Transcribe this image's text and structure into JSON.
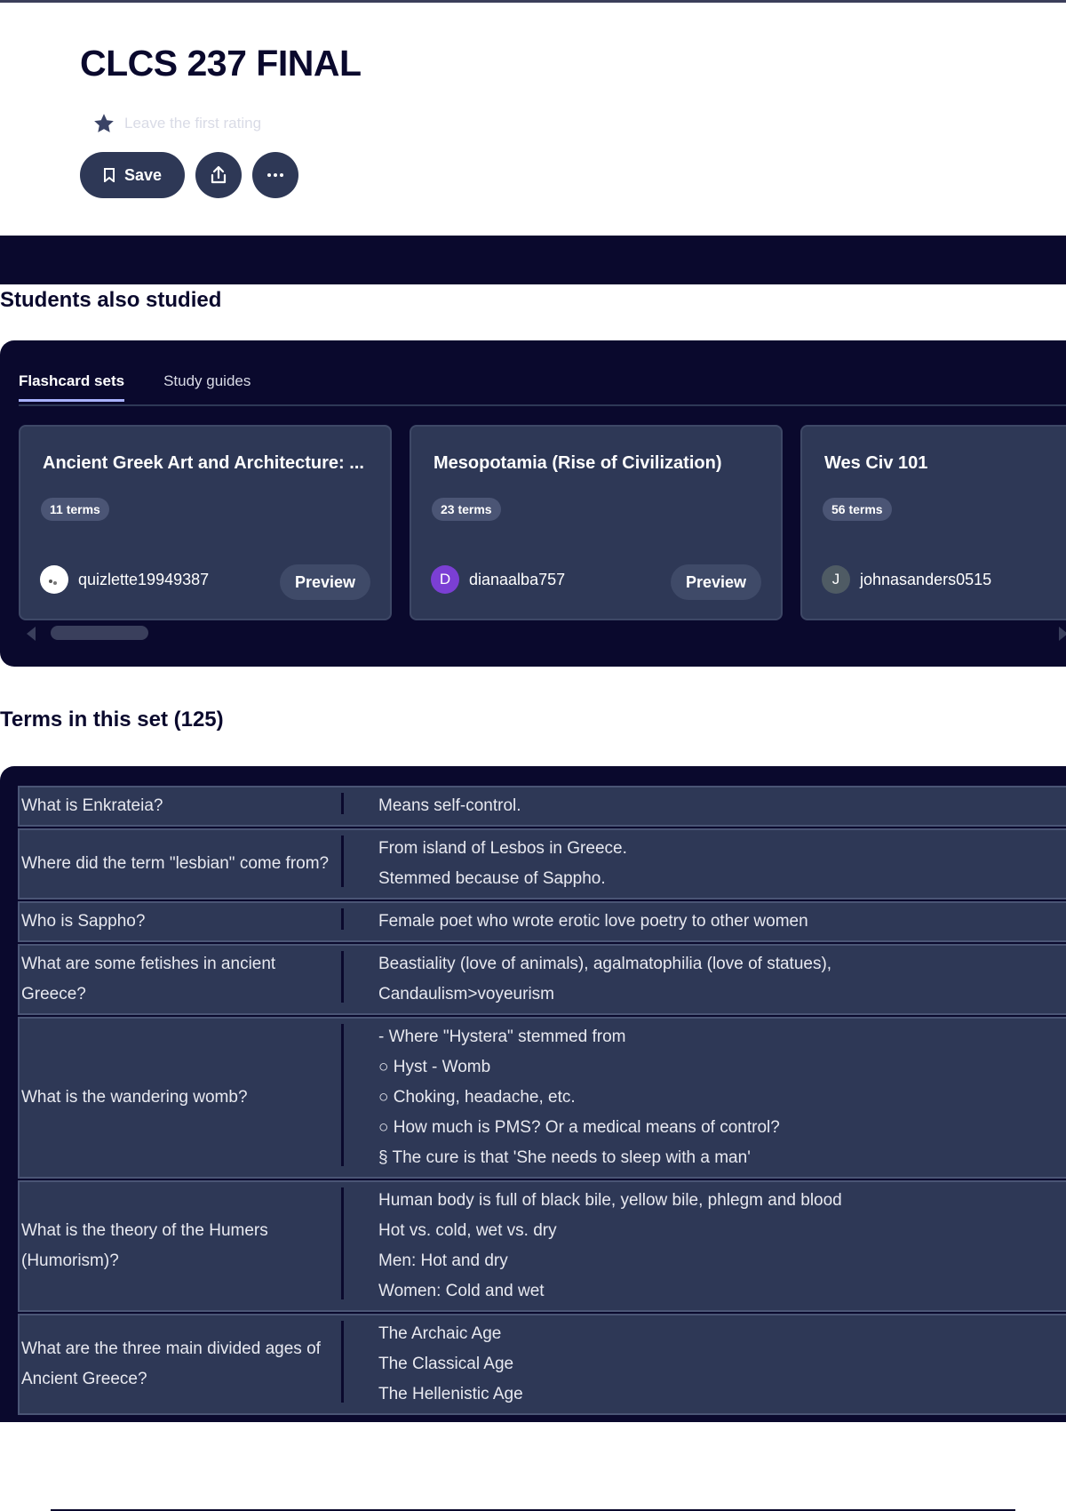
{
  "header": {
    "title": "CLCS 237 FINAL",
    "rating_text": "Leave the first rating",
    "save_label": "Save"
  },
  "students_also_studied": {
    "title": "Students also studied",
    "tabs": [
      {
        "label": "Flashcard sets",
        "active": true
      },
      {
        "label": "Study guides",
        "active": false
      }
    ],
    "cards": [
      {
        "title": "Ancient Greek Art and Architecture: ...",
        "terms": "11 terms",
        "username": "quizlette19949387",
        "avatar_letter": "",
        "avatar_color": "#ffffff",
        "preview_label": "Preview"
      },
      {
        "title": "Mesopotamia (Rise of Civilization)",
        "terms": "23 terms",
        "username": "dianaalba757",
        "avatar_letter": "D",
        "avatar_color": "#7b3fd4",
        "preview_label": "Preview"
      },
      {
        "title": "Wes Civ 101",
        "terms": "56 terms",
        "username": "johnasanders0515",
        "avatar_letter": "J",
        "avatar_color": "#4f5b64",
        "preview_label": "Preview"
      }
    ]
  },
  "terms_section": {
    "title": "Terms in this set (125)",
    "rows": [
      {
        "term": "What is Enkrateia?",
        "definition": [
          "Means self-control."
        ]
      },
      {
        "term": "Where did the term \"lesbian\" come from?",
        "definition": [
          "From island of Lesbos in Greece.",
          "Stemmed because of Sappho."
        ]
      },
      {
        "term": "Who is Sappho?",
        "definition": [
          "Female poet who wrote erotic love poetry to other women"
        ]
      },
      {
        "term": "What are some fetishes in ancient Greece?",
        "definition": [
          "Beastiality (love of animals), agalmatophilia (love of statues),",
          "Candaulism>voyeurism"
        ]
      },
      {
        "term": "What is the wandering womb?",
        "definition": [
          "- Where \"Hystera\" stemmed from",
          "○ Hyst - Womb",
          "○ Choking, headache, etc.",
          "○ How much is PMS? Or a medical means of control?",
          "§ The cure is that 'She needs to sleep with a man'"
        ]
      },
      {
        "term": "What is the theory of the Humers (Humorism)?",
        "definition": [
          "Human body is full of black bile, yellow bile, phlegm and blood",
          "Hot vs. cold, wet vs. dry",
          "Men: Hot and dry",
          "Women: Cold and wet"
        ]
      },
      {
        "term": "What are the three main divided ages of Ancient Greece?",
        "definition": [
          "The Archaic Age",
          "The Classical Age",
          "The Hellenistic Age"
        ]
      }
    ]
  }
}
